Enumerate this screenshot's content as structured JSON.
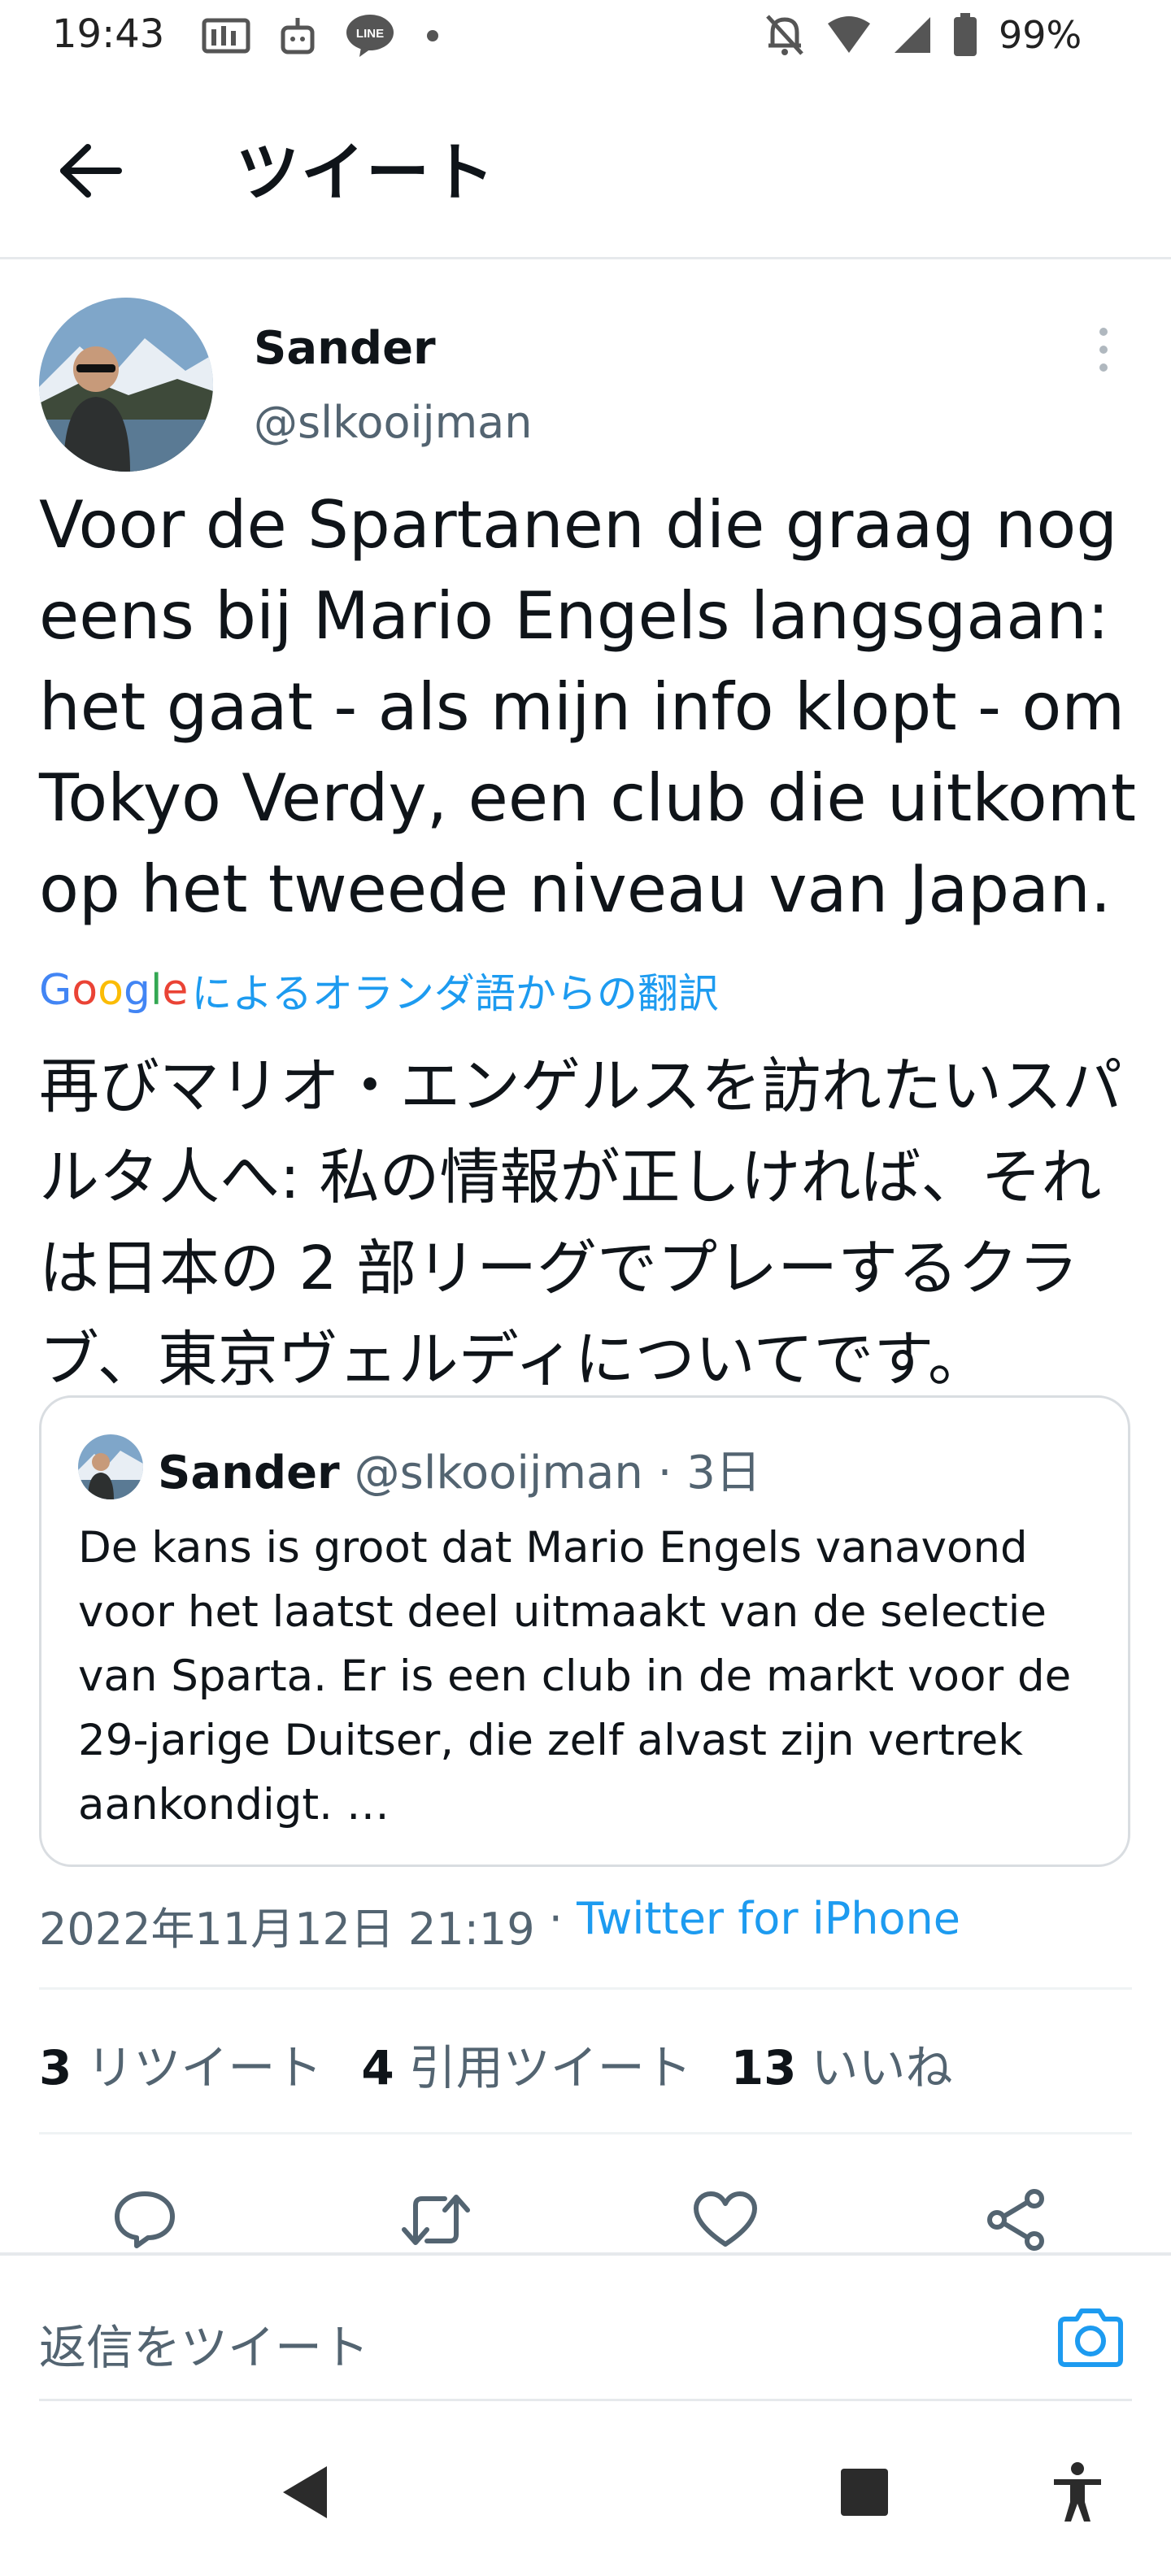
{
  "status_bar": {
    "time": "19:43",
    "battery": "99%",
    "icons_left": [
      "nfc-card-icon",
      "face-icon",
      "line-app-icon",
      "dot-icon"
    ],
    "icons_right": [
      "mute-bell-icon",
      "wifi-icon",
      "signal-icon",
      "battery-icon"
    ]
  },
  "header": {
    "title": "ツイート"
  },
  "tweet": {
    "author_name": "Sander",
    "author_handle": "@slkooijman",
    "text": "Voor de Spartanen die graag nog eens bij Mario Engels langsgaan: het gaat - als mijn info klopt - om Tokyo Verdy, een club die uitkomt op het tweede niveau van Japan.",
    "translation_brand": "Google",
    "translation_label": "によるオランダ語からの翻訳",
    "translated_text": "再びマリオ・エンゲルスを訪れたいスパルタ人へ: 私の情報が正しければ、それは日本の 2 部リーグでプレーするクラブ、東京ヴェルディについてです。",
    "timestamp": "2022年11月12日 21:19",
    "separator": " · ",
    "client": "Twitter for iPhone"
  },
  "quoted_tweet": {
    "author_name": "Sander",
    "author_handle": "@slkooijman",
    "separator": " · ",
    "age": "3日",
    "text": "De kans is groot dat Mario Engels vanavond voor het laatst deel uitmaakt van de selectie van Sparta. Er is een club in de markt voor de 29-jarige Duitser, die zelf alvast zijn vertrek aankondigt. …"
  },
  "stats": {
    "retweets_count": "3",
    "retweets_label": "リツイート",
    "quotes_count": "4",
    "quotes_label": "引用ツイート",
    "likes_count": "13",
    "likes_label": "いいね"
  },
  "actions": [
    "reply-icon",
    "retweet-icon",
    "like-icon",
    "share-icon"
  ],
  "reply_bar": {
    "placeholder": "返信をツイート"
  },
  "colors": {
    "accent": "#1d9bf0",
    "text": "#0f1419",
    "secondary": "#536471",
    "divider": "#eff3f4"
  }
}
